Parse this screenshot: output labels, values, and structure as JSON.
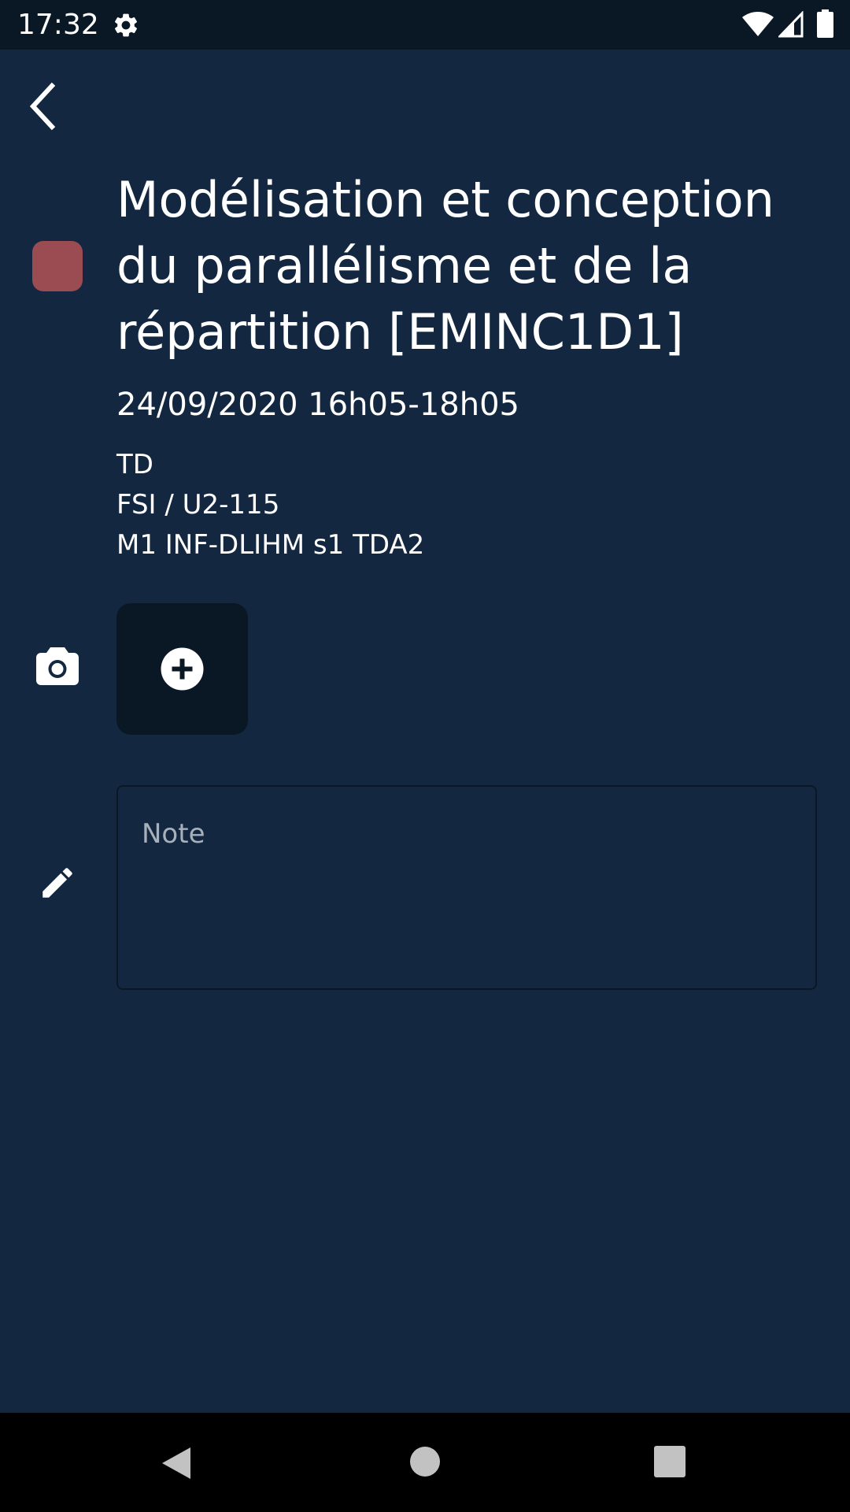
{
  "status_bar": {
    "time": "17:32",
    "icons": [
      "gear-icon",
      "wifi-icon",
      "signal-icon",
      "battery-icon"
    ]
  },
  "header": {
    "back_icon": "chevron-left-icon"
  },
  "event": {
    "color": "#9a4c52",
    "title": "Modélisation et conception du parallélisme et de la répartition [EMINC1D1]",
    "datetime": "24/09/2020 16h05-18h05",
    "type": "TD",
    "location": "FSI / U2-115",
    "group": "M1 INF-DLIHM s1 TDA2"
  },
  "photos": {
    "icon": "camera-icon",
    "add_icon": "plus-circle-icon"
  },
  "note": {
    "icon": "pencil-icon",
    "placeholder": "Note",
    "value": ""
  },
  "nav_bar": {
    "icons": [
      "nav-back-icon",
      "nav-home-icon",
      "nav-recents-icon"
    ]
  },
  "colors": {
    "background": "#132840",
    "status_bar": "#0a1826",
    "card": "#0a1826",
    "text": "#ffffff",
    "placeholder": "#a8b0ba"
  }
}
